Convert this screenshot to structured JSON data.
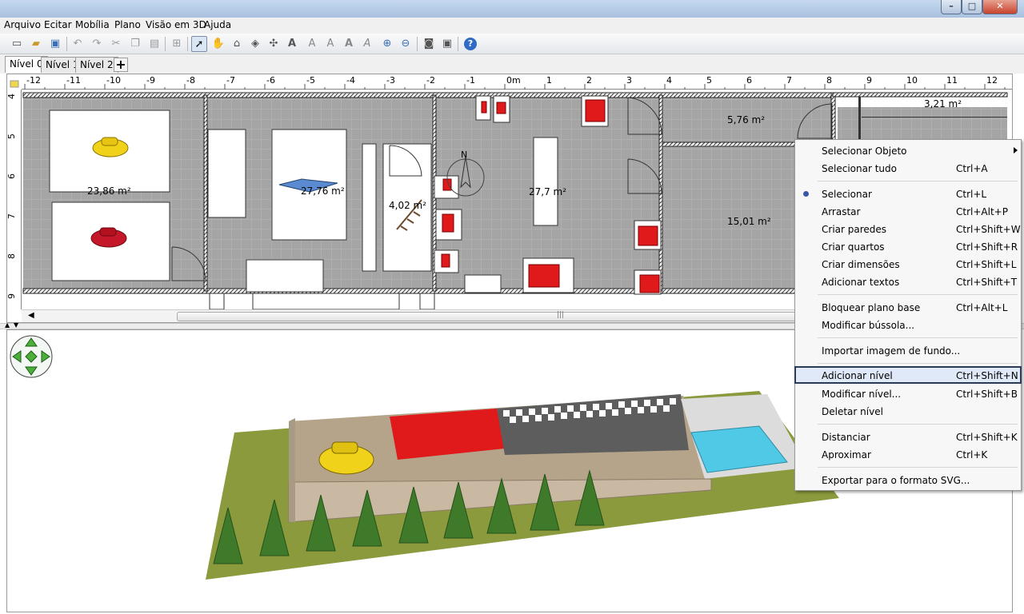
{
  "window": {
    "minimize_label": "–",
    "maximize_label": "□",
    "close_label": "✕"
  },
  "menubar": {
    "items": [
      "Arquivo",
      "Ecitar",
      "Mobília",
      "Plano",
      "Visão em 3D",
      "Ajuda"
    ]
  },
  "toolbar": {
    "icons": [
      "new-file",
      "open-folder",
      "save",
      "undo",
      "redo",
      "cut",
      "copy",
      "paste",
      "add-furniture",
      "select-arrow",
      "pan-hand",
      "create-walls",
      "create-rooms",
      "create-dimensions",
      "add-text",
      "text-style-1",
      "text-style-2",
      "text-style-3",
      "text-style-4",
      "zoom-in",
      "zoom-out",
      "create-photo",
      "create-video",
      "help"
    ]
  },
  "level_tabs": {
    "tabs": [
      "Nível 0",
      "Nível 1",
      "Nível 2"
    ],
    "active": 0,
    "add_label": "+"
  },
  "plan": {
    "ruler_h": [
      "-12",
      "-11",
      "-10",
      "-9",
      "-8",
      "-7",
      "-6",
      "-5",
      "-4",
      "-3",
      "-2",
      "-1",
      "0m",
      "1",
      "2",
      "3",
      "4",
      "5",
      "6",
      "7",
      "8",
      "9",
      "10",
      "11",
      "12"
    ],
    "ruler_v": [
      "4",
      "5",
      "6",
      "7",
      "8",
      "9"
    ],
    "room_areas": [
      "23,86 m²",
      "27,76 m²",
      "4,02 m²",
      "27,7 m²",
      "5,76 m²",
      "15,01 m²",
      "3,21 m²"
    ],
    "compass_label": "N",
    "scroll_grip": "|||"
  },
  "context_menu": {
    "items": [
      {
        "label": "Selecionar Objeto",
        "shortcut": "",
        "submenu": true
      },
      {
        "label": "Selecionar tudo",
        "shortcut": "Ctrl+A"
      },
      {
        "label": "Selecionar",
        "shortcut": "Ctrl+L",
        "checked": true
      },
      {
        "label": "Arrastar",
        "shortcut": "Ctrl+Alt+P"
      },
      {
        "label": "Criar paredes",
        "shortcut": "Ctrl+Shift+W"
      },
      {
        "label": "Criar quartos",
        "shortcut": "Ctrl+Shift+R"
      },
      {
        "label": "Criar dimensões",
        "shortcut": "Ctrl+Shift+L"
      },
      {
        "label": "Adicionar textos",
        "shortcut": "Ctrl+Shift+T"
      },
      {
        "label": "Bloquear plano base",
        "shortcut": "Ctrl+Alt+L"
      },
      {
        "label": "Modificar bússola...",
        "shortcut": ""
      },
      {
        "label": "Importar imagem de fundo...",
        "shortcut": ""
      },
      {
        "label": "Adicionar nível",
        "shortcut": "Ctrl+Shift+N",
        "highlighted": true
      },
      {
        "label": "Modificar nível...",
        "shortcut": "Ctrl+Shift+B"
      },
      {
        "label": "Deletar nível",
        "shortcut": ""
      },
      {
        "label": "Distanciar",
        "shortcut": "Ctrl+Shift+K"
      },
      {
        "label": "Aproximar",
        "shortcut": "Ctrl+K"
      },
      {
        "label": "Exportar para o formato SVG...",
        "shortcut": ""
      }
    ]
  },
  "colors": {
    "wall": "#444444",
    "floor": "#a3a3a3",
    "grass": "#8a9a3c",
    "wall3d": "#c9b9a3",
    "red_accent": "#e0191b",
    "pool": "#4fc9e6",
    "highlight_border": "#2b3a55"
  }
}
